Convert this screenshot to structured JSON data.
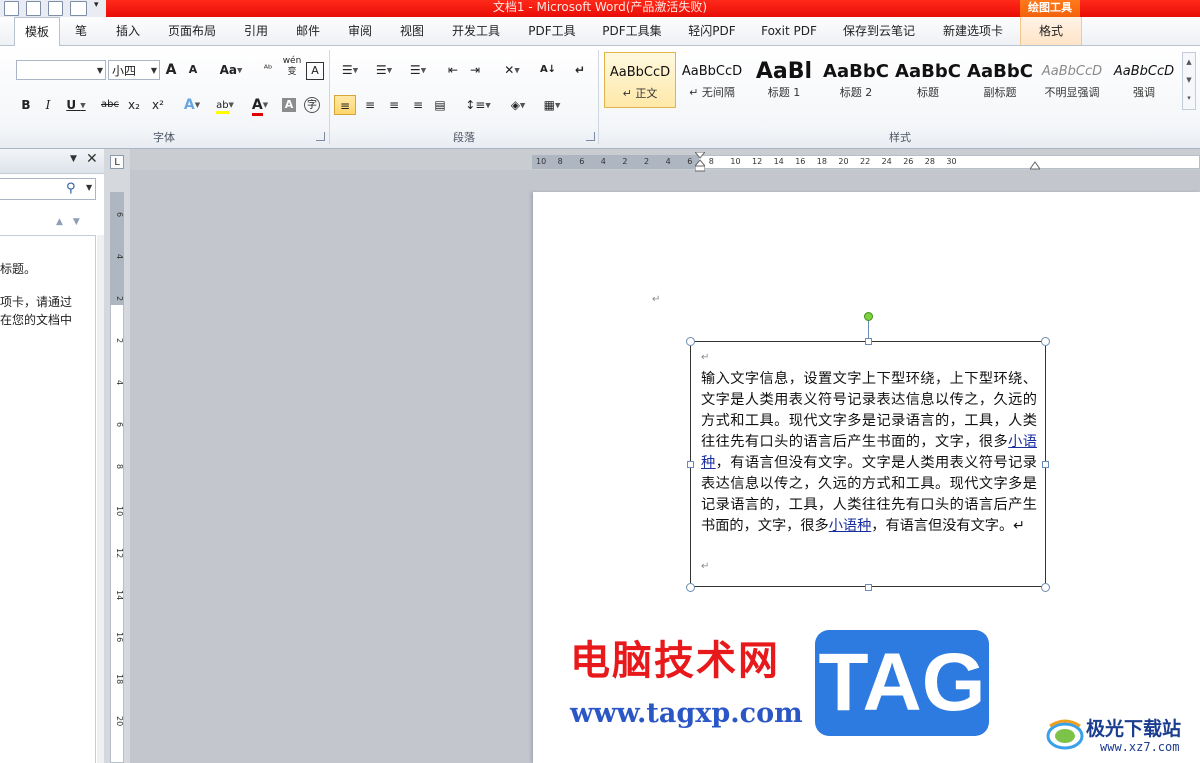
{
  "window": {
    "title": "文档1 - Microsoft Word(产品激活失败)",
    "context_group": "绘图工具"
  },
  "tabs": [
    {
      "label": "模板"
    },
    {
      "label": "笔"
    },
    {
      "label": "插入"
    },
    {
      "label": "页面布局"
    },
    {
      "label": "引用"
    },
    {
      "label": "邮件"
    },
    {
      "label": "审阅"
    },
    {
      "label": "视图"
    },
    {
      "label": "开发工具"
    },
    {
      "label": "PDF工具"
    },
    {
      "label": "PDF工具集"
    },
    {
      "label": "轻闪PDF"
    },
    {
      "label": "Foxit PDF"
    },
    {
      "label": "保存到云笔记"
    },
    {
      "label": "新建选项卡"
    },
    {
      "label": "格式"
    }
  ],
  "ribbon": {
    "font": {
      "group_label": "字体",
      "font_name": "",
      "font_size": "小四",
      "grow": "A",
      "shrink": "A",
      "change_case": "Aa",
      "bold": "B",
      "italic": "I",
      "underline": "U",
      "strike": "abc",
      "subscript": "x₂",
      "superscript": "x²",
      "text_effect": "A",
      "highlight": "ab",
      "font_color": "A",
      "char_shading": "A",
      "enclose": "字",
      "phonetic": "wén",
      "phonetic_char": "变",
      "char_border": "A"
    },
    "paragraph": {
      "group_label": "段落",
      "sort": "A↓",
      "show_marks": "↵"
    },
    "styles": {
      "group_label": "样式",
      "items": [
        {
          "preview": "AaBbCcD",
          "name": "↵ 正文"
        },
        {
          "preview": "AaBbCcD",
          "name": "↵ 无间隔"
        },
        {
          "preview": "AaBl",
          "name": "标题 1"
        },
        {
          "preview": "AaBbC",
          "name": "标题 2"
        },
        {
          "preview": "AaBbC",
          "name": "标题"
        },
        {
          "preview": "AaBbC",
          "name": "副标题"
        },
        {
          "preview": "AaBbCcD",
          "name": "不明显强调"
        },
        {
          "preview": "AaBbCcD",
          "name": "强调"
        }
      ]
    }
  },
  "nav_pane": {
    "line1": "标题。",
    "line2": "项卡，请通过",
    "line3": "在您的文档中"
  },
  "ruler": {
    "corner": "L",
    "h_ticks": [
      "10",
      "8",
      "6",
      "4",
      "2",
      "2",
      "4",
      "6",
      "8",
      "10",
      "12",
      "14",
      "16",
      "18",
      "20",
      "22",
      "24",
      "26",
      "28",
      "30"
    ],
    "v_ticks": [
      "6",
      "4",
      "2",
      "2",
      "4",
      "6",
      "8",
      "10",
      "12",
      "14",
      "16",
      "18",
      "20"
    ]
  },
  "document": {
    "para_mark": "↵",
    "textbox": {
      "part1": "输入文字信息，设置文字上下型环绕，上下型环绕、文字是人类用表义符号记录表达信息以传之，久远的方式和工具。现代文字多是记录语言的，工具，人类往往先有口头的语言后产生书面的，文字，很多",
      "link1": "小语种",
      "part2": "，有语言但没有文字。文字是人类用表义符号记录表达信息以传之，久远的方式和工具。现代文字多是记录语言的，工具，人类往往先有口头的语言后产生书面的，文字，很多",
      "link2": "小语种",
      "part3": "，有语言但没有文字。↵"
    }
  },
  "watermark": {
    "cn": "电脑技术网",
    "url": "www.tagxp.com",
    "tag": "TAG",
    "site_name": "极光下载站",
    "site_url": "www.xz7.com"
  }
}
